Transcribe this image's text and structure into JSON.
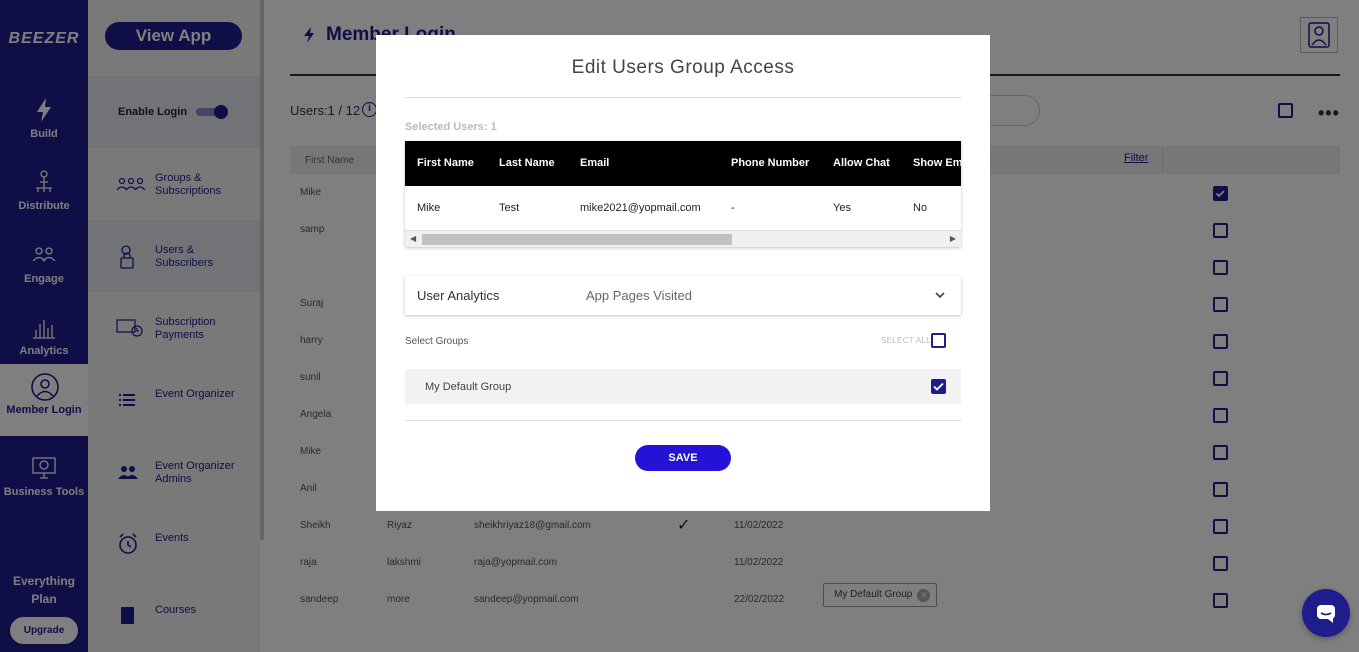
{
  "brand": {
    "logo": "BEEZER",
    "accent": "#1f1c8c"
  },
  "rail": {
    "items": [
      {
        "label": "Build",
        "icon": "bolt-icon"
      },
      {
        "label": "Distribute",
        "icon": "distribute-icon"
      },
      {
        "label": "Engage",
        "icon": "engage-icon"
      },
      {
        "label": "Analytics",
        "icon": "analytics-icon"
      },
      {
        "label": "Member Login",
        "icon": "member-login-icon",
        "active": true
      },
      {
        "label": "Business Tools",
        "icon": "business-tools-icon"
      }
    ],
    "plan_line1": "Everything",
    "plan_line2": "Plan",
    "upgrade": "Upgrade"
  },
  "sidebar": {
    "view_app": "View App",
    "enable_login": "Enable Login",
    "items": [
      {
        "label": "Groups & Subscriptions",
        "icon": "groups-icon"
      },
      {
        "label": "Users & Subscribers",
        "icon": "user-lock-icon",
        "active": true
      },
      {
        "label": "Subscription Payments",
        "icon": "payments-icon"
      },
      {
        "label": "Event Organizer",
        "icon": "list-icon"
      },
      {
        "label": "Event Organizer Admins",
        "icon": "admins-icon"
      },
      {
        "label": "Events",
        "icon": "alarm-icon"
      },
      {
        "label": "Courses",
        "icon": "book-icon"
      }
    ]
  },
  "main": {
    "title": "Member Login",
    "users_count": "Users:1 / 12",
    "info": "i",
    "more": "•••",
    "table": {
      "first_name_header": "First Name",
      "filter": "Filter",
      "rows": [
        {
          "first": "Mike",
          "last": "",
          "email": "",
          "check": "",
          "date": "",
          "group": "",
          "selected": true
        },
        {
          "first": "samp",
          "last": "",
          "email": "",
          "check": "",
          "date": "",
          "group": "",
          "selected": false
        },
        {
          "first": "",
          "last": "",
          "email": "",
          "check": "",
          "date": "",
          "group": "",
          "selected": false
        },
        {
          "first": "Suraj",
          "last": "",
          "email": "",
          "check": "",
          "date": "",
          "group": "",
          "selected": false
        },
        {
          "first": "harry",
          "last": "",
          "email": "",
          "check": "",
          "date": "",
          "group": "",
          "selected": false
        },
        {
          "first": "sunil",
          "last": "",
          "email": "",
          "check": "",
          "date": "",
          "group": "",
          "selected": false
        },
        {
          "first": "Angela",
          "last": "",
          "email": "",
          "check": "",
          "date": "",
          "group": "",
          "selected": false
        },
        {
          "first": "Mike",
          "last": "",
          "email": "",
          "check": "",
          "date": "",
          "group": "",
          "selected": false
        },
        {
          "first": "Anil",
          "last": "",
          "email": "",
          "check": "",
          "date": "",
          "group": "",
          "selected": false
        },
        {
          "first": "Sheikh",
          "last": "Riyaz",
          "email": "sheikhriyaz18@gmail.com",
          "check": "✓",
          "date": "11/02/2022",
          "group": "",
          "selected": false
        },
        {
          "first": "raja",
          "last": "lakshmi",
          "email": "raja@yopmail.com",
          "check": "",
          "date": "11/02/2022",
          "group": "",
          "selected": false
        },
        {
          "first": "sandeep",
          "last": "more",
          "email": "sandeep@yopmail.com",
          "check": "",
          "date": "22/02/2022",
          "group": "My Default Group",
          "selected": false
        }
      ]
    }
  },
  "modal": {
    "title": "Edit Users Group Access",
    "selected_users": "Selected Users: 1",
    "columns": [
      "First Name",
      "Last Name",
      "Email",
      "Phone Number",
      "Allow Chat",
      "Show Em"
    ],
    "row": [
      "Mike",
      "Test",
      "mike2021@yopmail.com",
      "-",
      "Yes",
      "No"
    ],
    "analytics_label": "User Analytics",
    "analytics_value": "App Pages Visited",
    "select_groups": "Select Groups",
    "select_all": "SELECT ALL",
    "groups": [
      {
        "name": "My Default Group",
        "checked": true
      }
    ],
    "save": "SAVE"
  }
}
